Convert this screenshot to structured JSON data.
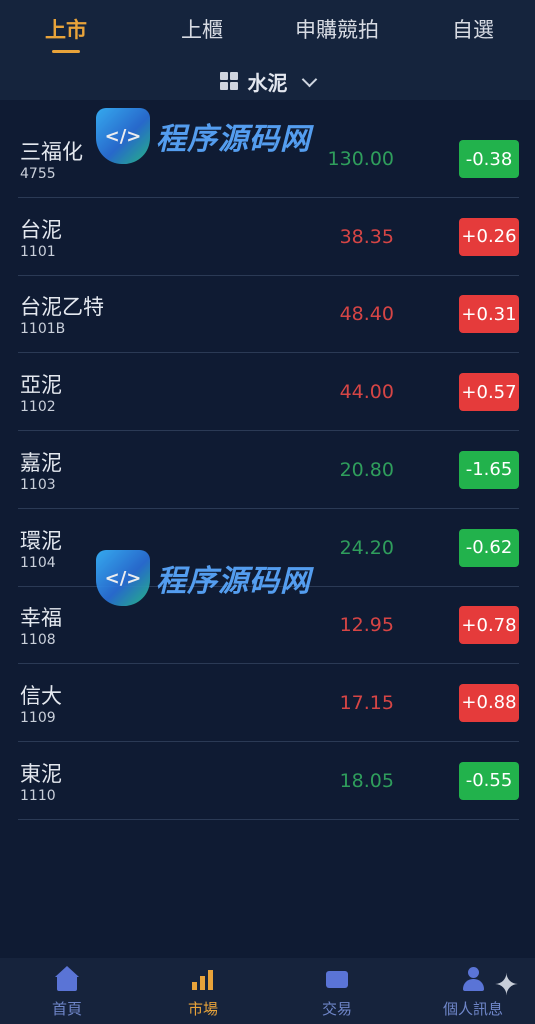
{
  "tabs": [
    {
      "label": "上市",
      "active": true
    },
    {
      "label": "上櫃",
      "active": false
    },
    {
      "label": "申購競拍",
      "active": false
    },
    {
      "label": "自選",
      "active": false
    }
  ],
  "category": {
    "label": "水泥",
    "icon": "grid-icon",
    "dropdown_icon": "chevron-down-icon"
  },
  "stocks": [
    {
      "name": "三福化",
      "code": "4755",
      "price": "130.00",
      "change": "-0.38",
      "direction": "down"
    },
    {
      "name": "台泥",
      "code": "1101",
      "price": "38.35",
      "change": "+0.26",
      "direction": "up"
    },
    {
      "name": "台泥乙特",
      "code": "1101B",
      "price": "48.40",
      "change": "+0.31",
      "direction": "up"
    },
    {
      "name": "亞泥",
      "code": "1102",
      "price": "44.00",
      "change": "+0.57",
      "direction": "up"
    },
    {
      "name": "嘉泥",
      "code": "1103",
      "price": "20.80",
      "change": "-1.65",
      "direction": "down"
    },
    {
      "name": "環泥",
      "code": "1104",
      "price": "24.20",
      "change": "-0.62",
      "direction": "down"
    },
    {
      "name": "幸福",
      "code": "1108",
      "price": "12.95",
      "change": "+0.78",
      "direction": "up"
    },
    {
      "name": "信大",
      "code": "1109",
      "price": "17.15",
      "change": "+0.88",
      "direction": "up"
    },
    {
      "name": "東泥",
      "code": "1110",
      "price": "18.05",
      "change": "-0.55",
      "direction": "down"
    }
  ],
  "watermark": {
    "text": "程序源码网",
    "shield": "</>"
  },
  "bottom_nav": [
    {
      "label": "首頁",
      "icon": "home-icon",
      "active": false
    },
    {
      "label": "市場",
      "icon": "chart-icon",
      "active": true
    },
    {
      "label": "交易",
      "icon": "wallet-icon",
      "active": false
    },
    {
      "label": "個人訊息",
      "icon": "user-icon",
      "active": false
    }
  ],
  "colors": {
    "accent": "#e8a33a",
    "up": "#e53b3b",
    "down": "#22b24c",
    "background": "#0f1b33"
  }
}
